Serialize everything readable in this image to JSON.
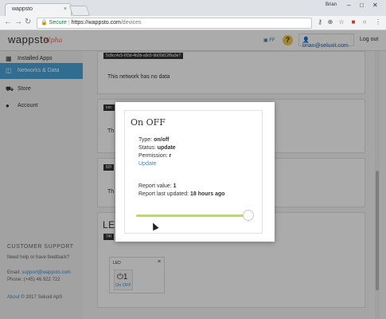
{
  "browser": {
    "tab_title": "wappsto",
    "tab_close": "×",
    "user": "Brian",
    "url_secure": "Secure",
    "url_host": "https://wappsto.com",
    "url_path": "/devices"
  },
  "header": {
    "logo": "wappsto",
    "logo_tag": "Alpha",
    "flag_label": "FF",
    "help_label": "?",
    "user_email": "brian@seluxit.com",
    "logout_label": "Log out"
  },
  "sidebar": {
    "items": [
      {
        "label": "Installed Apps",
        "icon": "grid-icon"
      },
      {
        "label": "Networks & Data",
        "icon": "network-icon"
      },
      {
        "label": "Store",
        "icon": "cart-icon"
      },
      {
        "label": "Account",
        "icon": "user-icon"
      }
    ],
    "support_title": "CUSTOMER SUPPORT",
    "support_question": "Need help or have feedback?",
    "email_label": "Email:",
    "email": "support@wappsto.com",
    "phone_label": "Phone:",
    "phone": "(+45) 46 922 722",
    "about": "About",
    "copyright": "© 2017 Seluxit ApS"
  },
  "main": {
    "card1_badge": "5c8cc4c5-6f3d-4b2b-a9c5-9b00d12f6a3e7",
    "card1_text": "This network has no data",
    "card2_badge": "cec",
    "card2_text": "Th",
    "card3_badge": "82f",
    "card3_text": "Th",
    "card4_title": "LE",
    "card4_badge": "74f",
    "widget_label": "LED",
    "widget_menu": "≡",
    "widget_value": "1",
    "widget_name": "On OFF"
  },
  "modal": {
    "title": "On OFF",
    "type_label": "Type:",
    "type_value": "on/off",
    "status_label": "Status:",
    "status_value": "update",
    "permission_label": "Permission:",
    "permission_value": "r",
    "update_link": "Update",
    "report_value_label": "Report value:",
    "report_value": "1",
    "report_updated_label": "Report last updated:",
    "report_updated": "18 hours ago",
    "slider_value": 1
  }
}
